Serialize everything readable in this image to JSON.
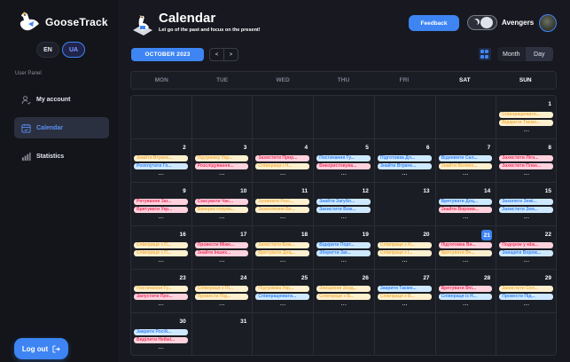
{
  "brand": "GooseTrack",
  "languages": [
    {
      "label": "EN",
      "active": false
    },
    {
      "label": "UA",
      "active": true
    }
  ],
  "sidebar": {
    "panel_title": "User Panel",
    "items": [
      {
        "label": "My account",
        "icon": "user-check-icon",
        "active": false
      },
      {
        "label": "Calendar",
        "icon": "calendar-check-icon",
        "active": true
      },
      {
        "label": "Statistics",
        "icon": "bar-chart-icon",
        "active": false
      }
    ],
    "logout_label": "Log out"
  },
  "header": {
    "title": "Calendar",
    "subtitle": "Let go of the past and focus on the present!",
    "feedback_label": "Feedback",
    "username": "Avengers"
  },
  "toolbar": {
    "period": "OCTOBER 2023",
    "prev": "<",
    "next": ">",
    "views": [
      {
        "label": "Month",
        "active": false
      },
      {
        "label": "Day",
        "active": true
      }
    ]
  },
  "weekdays": [
    {
      "label": "MON",
      "weekend": false
    },
    {
      "label": "TUE",
      "weekend": false
    },
    {
      "label": "WED",
      "weekend": false
    },
    {
      "label": "THU",
      "weekend": false
    },
    {
      "label": "FRI",
      "weekend": false
    },
    {
      "label": "SAT",
      "weekend": true
    },
    {
      "label": "SUN",
      "weekend": true
    }
  ],
  "colors": {
    "accent": "#3e85f3",
    "low": "#3e85f3",
    "medium": "#f3b249",
    "high": "#ea3d65"
  },
  "calendar": {
    "today": 21,
    "weeks": [
      [
        null,
        null,
        null,
        null,
        null,
        null,
        {
          "date": 1,
          "tasks": [
            {
              "t": "Співпрацювати...",
              "p": "med"
            },
            {
              "t": "Відкрити Таємн...",
              "p": "med"
            }
          ],
          "more": "..."
        }
      ],
      [
        {
          "date": 2,
          "tasks": [
            {
              "t": "Знайти Втраче...",
              "p": "med"
            },
            {
              "t": "Розплутати Го...",
              "p": "low"
            }
          ],
          "more": "..."
        },
        {
          "date": 3,
          "tasks": [
            {
              "t": "Підтримку Укр...",
              "p": "med"
            },
            {
              "t": "Розслідування...",
              "p": "high"
            }
          ],
          "more": "..."
        },
        {
          "date": 4,
          "tasks": [
            {
              "t": "Захистити Прир...",
              "p": "high"
            },
            {
              "t": "Співпраця і Н...",
              "p": "med"
            }
          ],
          "more": "..."
        },
        {
          "date": 5,
          "tasks": [
            {
              "t": "Постачання Гу...",
              "p": "low"
            },
            {
              "t": "Використовува...",
              "p": "high"
            }
          ],
          "more": "..."
        },
        {
          "date": 6,
          "tasks": [
            {
              "t": "Підготовка Дл...",
              "p": "low"
            },
            {
              "t": "Знайти Втраче...",
              "p": "low"
            }
          ],
          "more": "..."
        },
        {
          "date": 7,
          "tasks": [
            {
              "t": "Відновити Сал...",
              "p": "low"
            },
            {
              "t": "Знайти Велике...",
              "p": "med"
            }
          ],
          "more": "..."
        },
        {
          "date": 8,
          "tasks": [
            {
              "t": "Захистити Лігн...",
              "p": "high"
            },
            {
              "t": "Захистити План...",
              "p": "high"
            }
          ],
          "more": "..."
        }
      ],
      [
        {
          "date": 9,
          "tasks": [
            {
              "t": "Рятування Заг...",
              "p": "high"
            },
            {
              "t": "Врятувати Укр...",
              "p": "high"
            }
          ],
          "more": "..."
        },
        {
          "date": 10,
          "tasks": [
            {
              "t": "Скасувати Час...",
              "p": "high"
            },
            {
              "t": "Використовува...",
              "p": "med"
            }
          ],
          "more": "..."
        },
        {
          "date": 11,
          "tasks": [
            {
              "t": "Зупинити Росі...",
              "p": "med"
            },
            {
              "t": "Захоплення Бе...",
              "p": "med"
            }
          ],
          "more": "..."
        },
        {
          "date": 12,
          "tasks": [
            {
              "t": "Знайти Загубл...",
              "p": "low"
            },
            {
              "t": "Захистити Вож...",
              "p": "low"
            }
          ],
          "more": "..."
        },
        {
          "date": 13,
          "tasks": [],
          "more": ""
        },
        {
          "date": 14,
          "tasks": [
            {
              "t": "Врятувати Доц...",
              "p": "low"
            },
            {
              "t": "Знайти Ворожи...",
              "p": "high"
            }
          ],
          "more": "..."
        },
        {
          "date": 15,
          "tasks": [
            {
              "t": "Захопите Земі...",
              "p": "low"
            },
            {
              "t": "Захистити Зем...",
              "p": "low"
            }
          ],
          "more": "..."
        }
      ],
      [
        {
          "date": 16,
          "tasks": [
            {
              "t": "Співпраця з П...",
              "p": "med"
            },
            {
              "t": "Співпраця з П...",
              "p": "med"
            }
          ],
          "more": "..."
        },
        {
          "date": 17,
          "tasks": [
            {
              "t": "Провести Міжн...",
              "p": "high"
            },
            {
              "t": "Знайти Інших...",
              "p": "high"
            }
          ],
          "more": "..."
        },
        {
          "date": 18,
          "tasks": [
            {
              "t": "Захистити Вож...",
              "p": "med"
            },
            {
              "t": "Врятувати Доц...",
              "p": "med"
            }
          ],
          "more": "..."
        },
        {
          "date": 19,
          "tasks": [
            {
              "t": "Відкрити Порт...",
              "p": "low"
            },
            {
              "t": "Зберегти Заг...",
              "p": "low"
            }
          ],
          "more": "..."
        },
        {
          "date": 20,
          "tasks": [
            {
              "t": "Співпраця з Н...",
              "p": "med"
            },
            {
              "t": "Співпраця з І...",
              "p": "med"
            }
          ],
          "more": "..."
        },
        {
          "date": 21,
          "tasks": [
            {
              "t": "Підготовка Ви...",
              "p": "high"
            },
            {
              "t": "Врятувати Вч...",
              "p": "med"
            }
          ],
          "more": "..."
        },
        {
          "date": 22,
          "tasks": [
            {
              "t": "Подорож у між...",
              "p": "high"
            },
            {
              "t": "Знищити Ворож...",
              "p": "low"
            }
          ],
          "more": "..."
        }
      ],
      [
        {
          "date": 23,
          "tasks": [
            {
              "t": "Постачання Гу...",
              "p": "med"
            },
            {
              "t": "Запустити Про...",
              "p": "high"
            }
          ],
          "more": "..."
        },
        {
          "date": 24,
          "tasks": [
            {
              "t": "Співпраця з Пl...",
              "p": "med"
            },
            {
              "t": "Провести Під...",
              "p": "med"
            }
          ],
          "more": "..."
        },
        {
          "date": 25,
          "tasks": [
            {
              "t": "Підтримка Укр...",
              "p": "med"
            },
            {
              "t": "Співпрацювати...",
              "p": "low"
            }
          ],
          "more": "..."
        },
        {
          "date": 26,
          "tasks": [
            {
              "t": "Знищення Зозд...",
              "p": "med"
            },
            {
              "t": "Співпраця з В...",
              "p": "med"
            }
          ],
          "more": "..."
        },
        {
          "date": 27,
          "tasks": [
            {
              "t": "Закрити Таємн...",
              "p": "low"
            },
            {
              "t": "Співпраця з В...",
              "p": "med"
            }
          ],
          "more": "..."
        },
        {
          "date": 28,
          "tasks": [
            {
              "t": "Врятувати Вчі...",
              "p": "high"
            },
            {
              "t": "Співпраця із Н...",
              "p": "low"
            }
          ],
          "more": "..."
        },
        {
          "date": 29,
          "tasks": [
            {
              "t": "Захистити Сел...",
              "p": "med"
            },
            {
              "t": "Провести Під...",
              "p": "low"
            }
          ],
          "more": "..."
        }
      ],
      [
        {
          "date": 30,
          "tasks": [
            {
              "t": "Закрити Росій...",
              "p": "low"
            },
            {
              "t": "Виділити Неймі...",
              "p": "high"
            }
          ],
          "more": "..."
        },
        {
          "date": 31,
          "tasks": [],
          "more": ""
        },
        null,
        null,
        null,
        null,
        null
      ]
    ]
  }
}
